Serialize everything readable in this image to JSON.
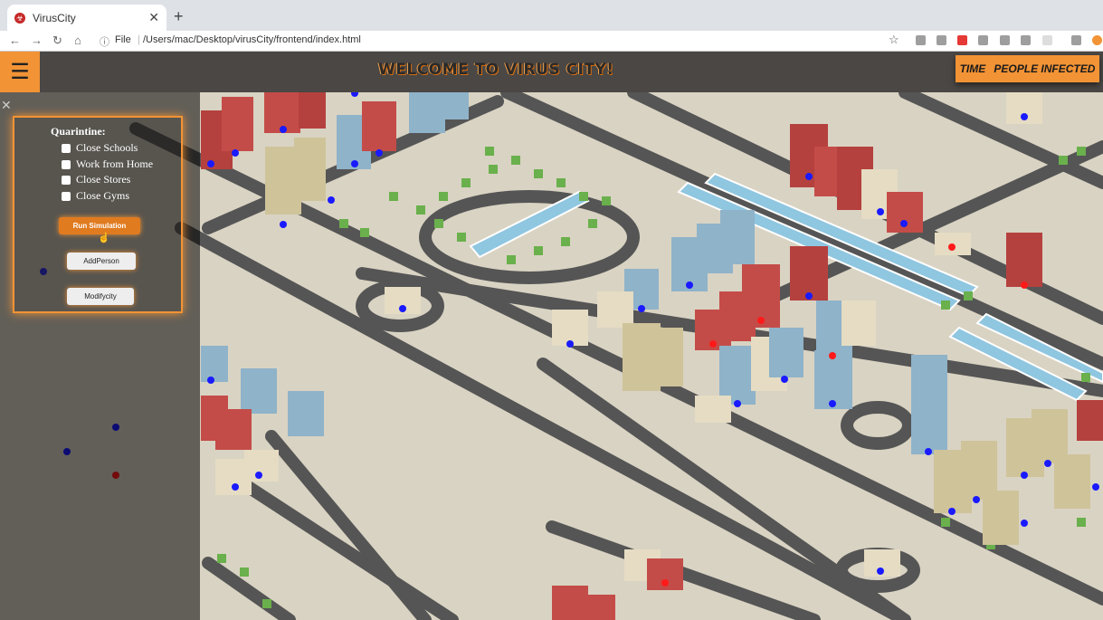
{
  "browser": {
    "tab_title": "VirusCity",
    "url_prefix": "File",
    "url": "/Users/mac/Desktop/virusCity/frontend/index.html"
  },
  "header": {
    "title": "WELCOME TO VIRUS CITY!",
    "time_label": "TIME",
    "infected_label": "PEOPLE INFECTED"
  },
  "panel": {
    "title": "Quarintine:",
    "options": [
      "Close Schools",
      "Work from Home",
      "Close Stores",
      "Close Gyms"
    ],
    "run_button": "Run Simulation",
    "add_button": "AddPerson",
    "modify_button": "Modifycity"
  },
  "colors": {
    "accent": "#f29335",
    "ground": "#d9d3c3",
    "road": "#555555",
    "healthy": "#1a1aff",
    "infected": "#ff1a1a"
  }
}
